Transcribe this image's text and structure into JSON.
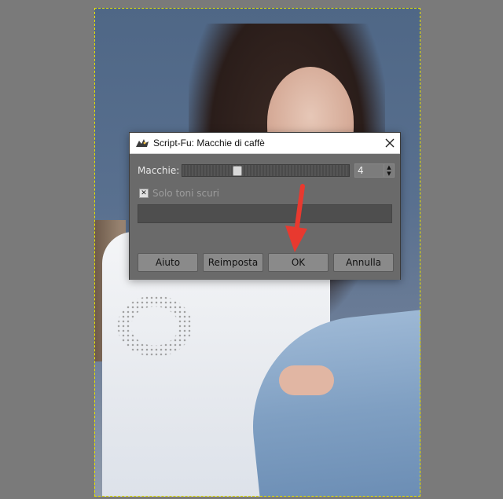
{
  "dialog": {
    "title": "Script-Fu: Macchie di caffè",
    "macchie_label": "Macchie:",
    "macchie_value": "4",
    "macchie_slider_fraction": 0.32,
    "checkbox_label": "Solo toni scuri",
    "checkbox_checked": true,
    "checkbox_mark": "✕",
    "buttons": {
      "help": "Aiuto",
      "reset": "Reimposta",
      "ok": "OK",
      "cancel": "Annulla"
    }
  },
  "icons": {
    "app": "gimp-wilber-icon",
    "close": "close-icon",
    "spin_up": "arrow-up-icon",
    "spin_down": "arrow-down-icon"
  },
  "colors": {
    "selection_border": "#e7e300",
    "annotation_arrow": "#e8392f"
  }
}
